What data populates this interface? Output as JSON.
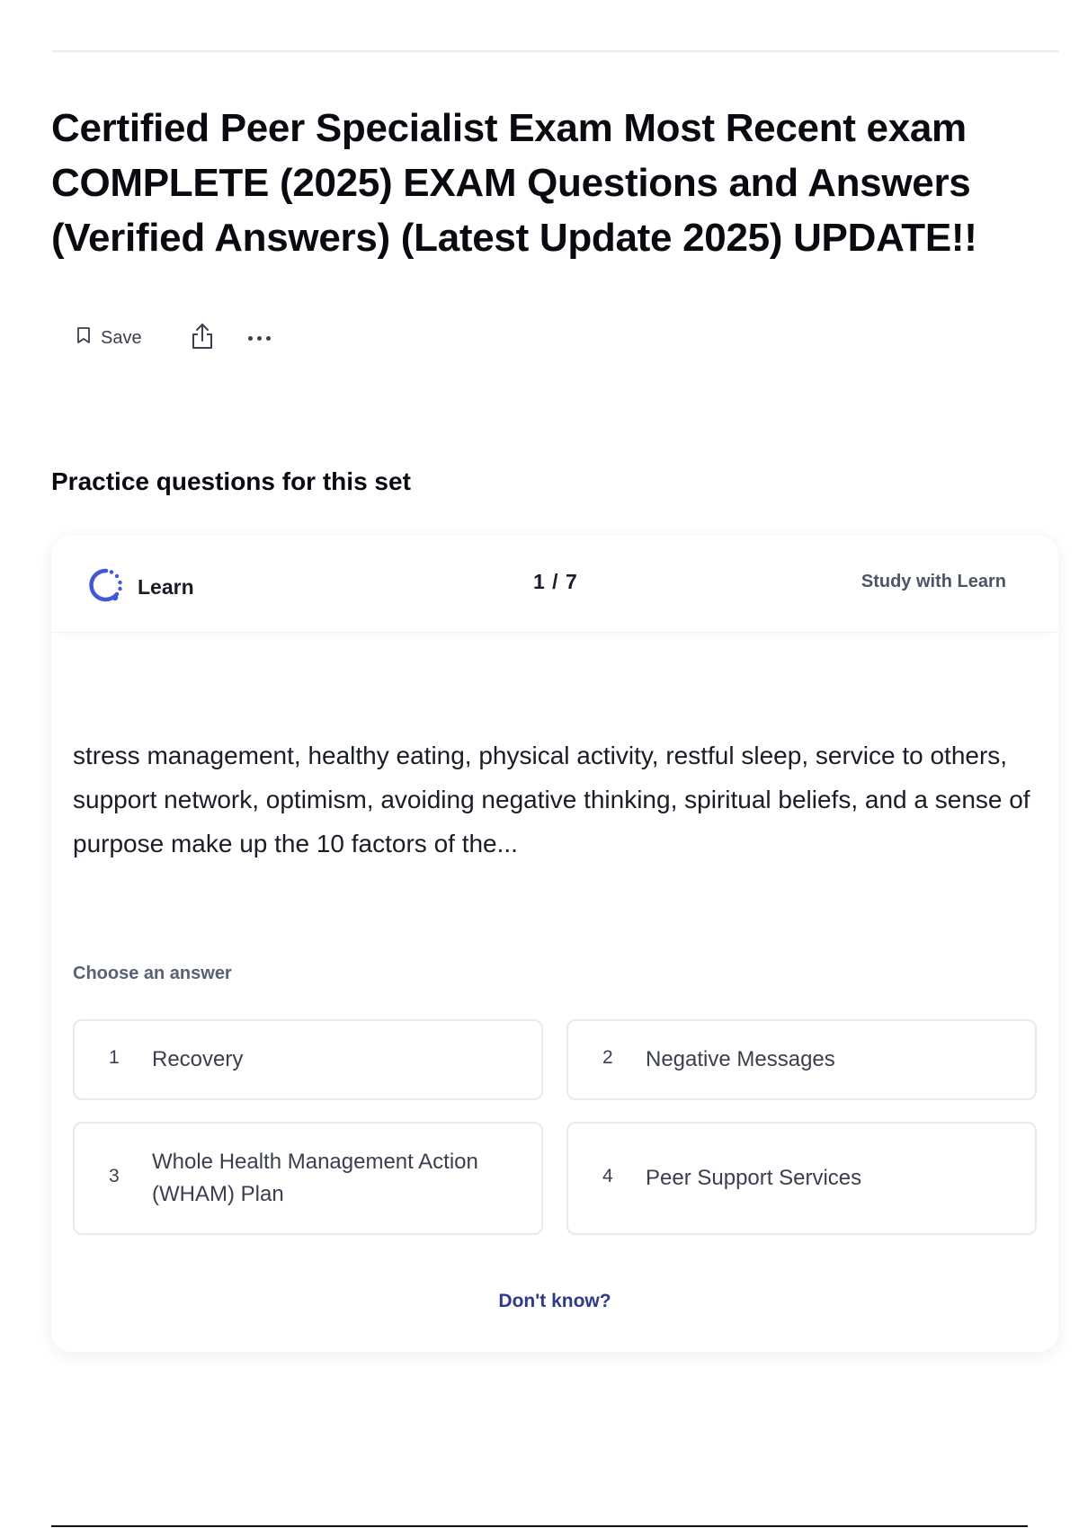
{
  "page": {
    "title": "Certified Peer Specialist Exam Most Recent exam COMPLETE (2025) EXAM Questions and Answers (Verified Answers) (Latest Update 2025) UPDATE!!"
  },
  "actions": {
    "save_label": "Save",
    "icons": [
      "bookmark-icon",
      "share-icon",
      "more-icon"
    ]
  },
  "practice": {
    "heading": "Practice questions for this set",
    "card": {
      "mode_label": "Learn",
      "progress": "1 / 7",
      "study_link": "Study with Learn",
      "question": "stress management, healthy eating, physical activity, restful sleep, service to others, support network, optimism, avoiding negative thinking, spiritual beliefs, and a sense of purpose make up the 10 factors of the...",
      "choose_label": "Choose an answer",
      "options": [
        {
          "number": "1",
          "text": "Recovery"
        },
        {
          "number": "2",
          "text": "Negative Messages"
        },
        {
          "number": "3",
          "text": "Whole Health Management Action (WHAM) Plan"
        },
        {
          "number": "4",
          "text": "Peer Support Services"
        }
      ],
      "dont_know": "Don't know?"
    }
  },
  "colors": {
    "accent_blue": "#4257d6",
    "link_dark_blue": "#2e3a8c",
    "text_primary": "#0a0b10",
    "text_secondary": "#3b3f4d",
    "border": "#e9e9ee"
  }
}
